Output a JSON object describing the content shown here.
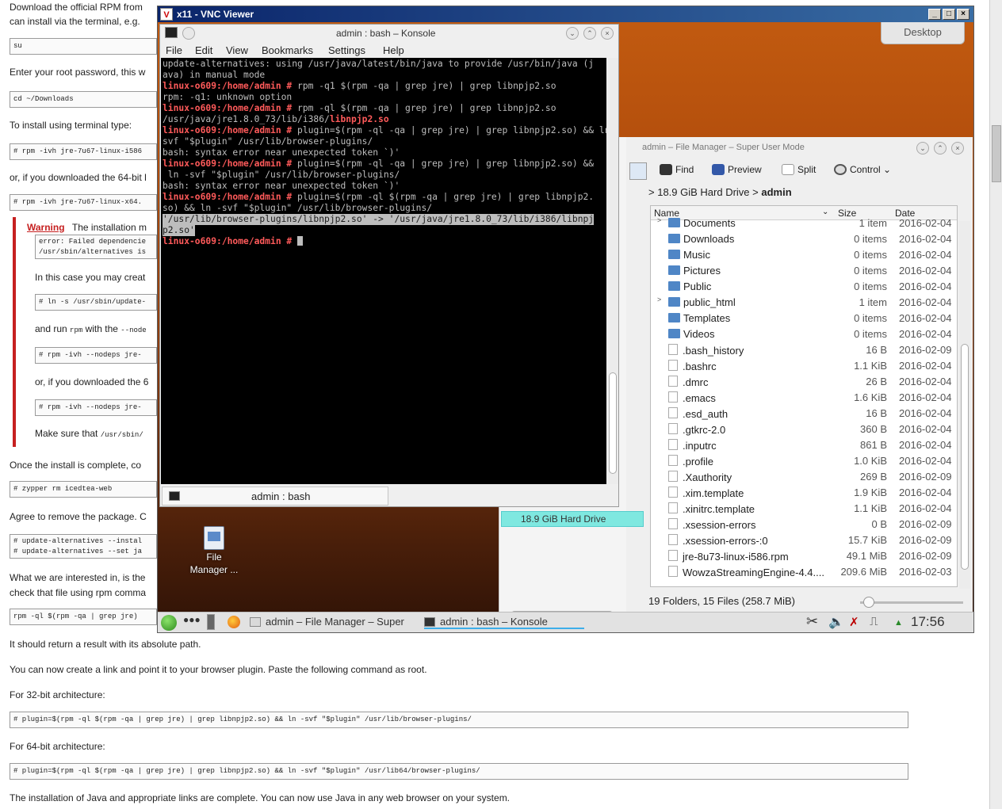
{
  "doc": {
    "line1": "Download the official RPM from",
    "line2": "can install via the terminal, e.g.",
    "code_su": "su",
    "enter_root": "Enter your root password, this w",
    "code_cd": "cd ~/Downloads",
    "install_terminal": "To install using terminal type:",
    "code_rpm": "# rpm -ivh jre-7u67-linux-i586",
    "or_64": "or, if you downloaded the 64-bit l",
    "code_rpm64": "# rpm -ivh jre-7u67-linux-x64.",
    "warning_title": "Warning",
    "warning_text": "The installation m",
    "warning_code1": "error: Failed dependencie",
    "warning_code2": "/usr/sbin/alternatives is",
    "in_this_case": "In this case you may creat",
    "code_ln": "# ln -s /usr/sbin/update-",
    "and_run_a": "and run",
    "and_run_rpm": "rpm",
    "and_run_b": "with the",
    "and_run_nodeps": "--node",
    "code_nodeps": "# rpm -ivh --nodeps jre-",
    "or_if_6": "or, if you downloaded the 6",
    "code_nodeps2": "# rpm -ivh --nodeps jre-",
    "make_sure_a": "Make sure that",
    "make_sure_b": "/usr/sbin/",
    "once_install": "Once the install is complete, co",
    "code_zypper": "# zypper rm icedtea-web",
    "agree_remove": "Agree to remove the package. C",
    "code_ua1": "# update-alternatives --instal",
    "code_ua2": "# update-alternatives --set ja",
    "what_interested": "What we are interested in, is the",
    "check_file": "check that file using rpm comma",
    "code_rpmql": "rpm -ql $(rpm -qa | grep jre)",
    "return_result": "It should return a result with its absolute path.",
    "create_link": "You can now create a link and point it to your browser plugin. Paste the following command as root.",
    "for32": "For 32-bit architecture:",
    "code32": "# plugin=$(rpm -ql $(rpm -qa | grep jre) | grep libnpjp2.so) && ln -svf \"$plugin\" /usr/lib/browser-plugins/",
    "for64": "For 64-bit architecture:",
    "code64": "# plugin=$(rpm -ql $(rpm -qa | grep jre) | grep libnpjp2.so) && ln -svf \"$plugin\" /usr/lib64/browser-plugins/",
    "complete": "The installation of Java and appropriate links are complete. You can now use Java in any web browser on your system."
  },
  "vnc": {
    "title": "x11 - VNC Viewer",
    "logo": "V",
    "btn_min": "_",
    "btn_max": "□",
    "btn_close": "×"
  },
  "desktop": {
    "widget_label": "Desktop",
    "fm_icon_label1": "File",
    "fm_icon_label2": "Manager ..."
  },
  "konsole": {
    "title": "admin : bash – Konsole",
    "menu": [
      "File",
      "Edit",
      "View",
      "Bookmarks",
      "Settings",
      "Help"
    ],
    "tab_label": "admin : bash",
    "prompt": "linux-o609:/home/admin #",
    "lines": {
      "l1": "update-alternatives: using /usr/java/latest/bin/java to provide /usr/bin/java (j",
      "l2": "ava) in manual mode",
      "l3_cmd": " rpm -q1 $(rpm -qa | grep jre) | grep libnpjp2.so",
      "l4": "rpm: -q1: unknown option",
      "l5_cmd": " rpm -ql $(rpm -qa | grep jre) | grep libnpjp2.so",
      "l6_a": "/usr/java/jre1.8.0_73/lib/i386/",
      "l6_b": "libnpjp2.so",
      "l7_cmd": " plugin=$(rpm -ql -qa | grep jre) | grep libnpjp2.so) && ln -",
      "l8": "svf \"$plugin\" /usr/lib/browser-plugins/",
      "l9": "bash: syntax error near unexpected token `)'",
      "l10_cmd": " plugin=$(rpm -ql -qa | grep jre) | grep libnpjp2.so) &&",
      "l11": " ln -svf \"$plugin\" /usr/lib/browser-plugins/",
      "l12": "bash: syntax error near unexpected token `)'",
      "l13_cmd": " plugin=$(rpm -ql $(rpm -qa | grep jre) | grep libnpjp2.",
      "l14": "so) && ln -svf \"$plugin\" /usr/lib/browser-plugins/",
      "l15": "'/usr/lib/browser-plugins/libnpjp2.so' -> '/usr/java/jre1.8.0_73/lib/i386/libnpj",
      "l16": "p2.so'"
    }
  },
  "filemanager": {
    "title": "admin – File Manager – Super User Mode",
    "toolbar": {
      "find": "Find",
      "preview": "Preview",
      "split": "Split",
      "control": "Control"
    },
    "breadcrumb_drive": "18.9 GiB Hard Drive",
    "breadcrumb_sep": ">",
    "breadcrumb_folder": "admin",
    "places_drive": "18.9 GiB Hard Drive",
    "columns": {
      "name": "Name",
      "size": "Size",
      "date": "Date"
    },
    "rows": [
      {
        "name": "Documents",
        "size": "1 item",
        "date": "2016-02-04",
        "type": "folder",
        "expand": ">"
      },
      {
        "name": "Downloads",
        "size": "0 items",
        "date": "2016-02-04",
        "type": "folder",
        "expand": ""
      },
      {
        "name": "Music",
        "size": "0 items",
        "date": "2016-02-04",
        "type": "folder",
        "expand": ""
      },
      {
        "name": "Pictures",
        "size": "0 items",
        "date": "2016-02-04",
        "type": "folder",
        "expand": ""
      },
      {
        "name": "Public",
        "size": "0 items",
        "date": "2016-02-04",
        "type": "folder",
        "expand": ""
      },
      {
        "name": "public_html",
        "size": "1 item",
        "date": "2016-02-04",
        "type": "folder",
        "expand": ">"
      },
      {
        "name": "Templates",
        "size": "0 items",
        "date": "2016-02-04",
        "type": "folder",
        "expand": ""
      },
      {
        "name": "Videos",
        "size": "0 items",
        "date": "2016-02-04",
        "type": "folder",
        "expand": ""
      },
      {
        "name": ".bash_history",
        "size": "16 B",
        "date": "2016-02-09",
        "type": "file",
        "expand": ""
      },
      {
        "name": ".bashrc",
        "size": "1.1 KiB",
        "date": "2016-02-04",
        "type": "file",
        "expand": ""
      },
      {
        "name": ".dmrc",
        "size": "26 B",
        "date": "2016-02-04",
        "type": "file",
        "expand": ""
      },
      {
        "name": ".emacs",
        "size": "1.6 KiB",
        "date": "2016-02-04",
        "type": "file",
        "expand": ""
      },
      {
        "name": ".esd_auth",
        "size": "16 B",
        "date": "2016-02-04",
        "type": "file",
        "expand": ""
      },
      {
        "name": ".gtkrc-2.0",
        "size": "360 B",
        "date": "2016-02-04",
        "type": "file",
        "expand": ""
      },
      {
        "name": ".inputrc",
        "size": "861 B",
        "date": "2016-02-04",
        "type": "file",
        "expand": ""
      },
      {
        "name": ".profile",
        "size": "1.0 KiB",
        "date": "2016-02-04",
        "type": "file",
        "expand": ""
      },
      {
        "name": ".Xauthority",
        "size": "269 B",
        "date": "2016-02-09",
        "type": "file",
        "expand": ""
      },
      {
        "name": ".xim.template",
        "size": "1.9 KiB",
        "date": "2016-02-04",
        "type": "file",
        "expand": ""
      },
      {
        "name": ".xinitrc.template",
        "size": "1.1 KiB",
        "date": "2016-02-04",
        "type": "file",
        "expand": ""
      },
      {
        "name": ".xsession-errors",
        "size": "0 B",
        "date": "2016-02-09",
        "type": "file",
        "expand": ""
      },
      {
        "name": ".xsession-errors-:0",
        "size": "15.7 KiB",
        "date": "2016-02-09",
        "type": "file",
        "expand": ""
      },
      {
        "name": "jre-8u73-linux-i586.rpm",
        "size": "49.1 MiB",
        "date": "2016-02-09",
        "type": "file",
        "expand": ""
      },
      {
        "name": "WowzaStreamingEngine-4.4....",
        "size": "209.6 MiB",
        "date": "2016-02-03",
        "type": "file",
        "expand": ""
      }
    ],
    "status": "19 Folders, 15 Files (258.7 MiB)"
  },
  "taskbar": {
    "task_fm": "admin – File Manager – Super",
    "task_konsole": "admin : bash – Konsole",
    "clock": "17:56"
  },
  "colors": {
    "prompt": "#ff5a5a",
    "selection": "#bdbdbd",
    "accent": "#3daee9",
    "desktop": "#b34e0c"
  }
}
